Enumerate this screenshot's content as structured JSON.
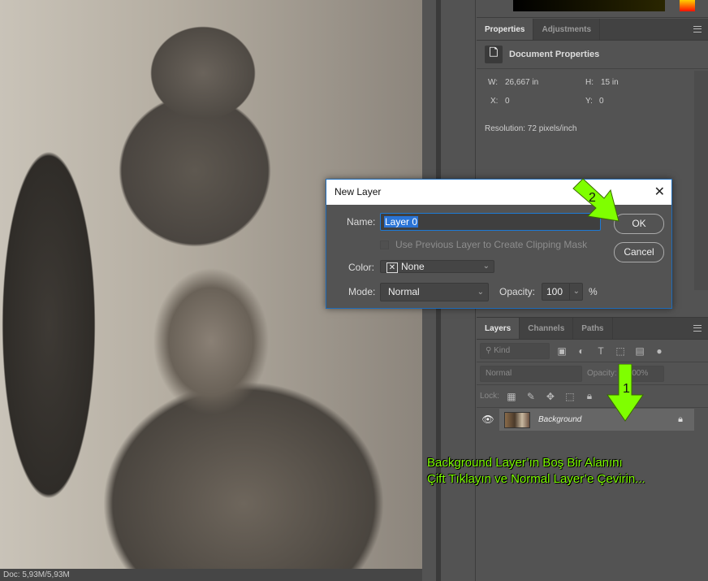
{
  "status": {
    "doc_size": "Doc: 5,93M/5,93M"
  },
  "properties": {
    "tabs": [
      "Properties",
      "Adjustments"
    ],
    "section": "Document Properties",
    "w_label": "W:",
    "w": "26,667 in",
    "h_label": "H:",
    "h": "15 in",
    "x_label": "X:",
    "x": "0",
    "y_label": "Y:",
    "y": "0",
    "resolution": "Resolution: 72 pixels/inch"
  },
  "layers": {
    "tabs": [
      "Layers",
      "Channels",
      "Paths"
    ],
    "filter": "Kind",
    "blend": "Normal",
    "opacity_label": "Opacity:",
    "opacity": "100%",
    "lock_label": "Lock:",
    "items": [
      {
        "name": "Background",
        "locked": true,
        "visible": true
      }
    ]
  },
  "dialog": {
    "title": "New Layer",
    "name_label": "Name:",
    "name_value": "Layer 0",
    "clip_label": "Use Previous Layer to Create Clipping Mask",
    "clip_checked": false,
    "color_label": "Color:",
    "color_value": "None",
    "mode_label": "Mode:",
    "mode_value": "Normal",
    "opacity_label": "Opacity:",
    "opacity_value": "100",
    "percent": "%",
    "ok": "OK",
    "cancel": "Cancel"
  },
  "annotation": {
    "line1": "Background Layer’ın Boş Bir Alanını",
    "line2": "Çift Tıklayın ve Normal Layer’e Çevirin...",
    "step1": "1",
    "step2": "2",
    "color": "#7fff00"
  }
}
